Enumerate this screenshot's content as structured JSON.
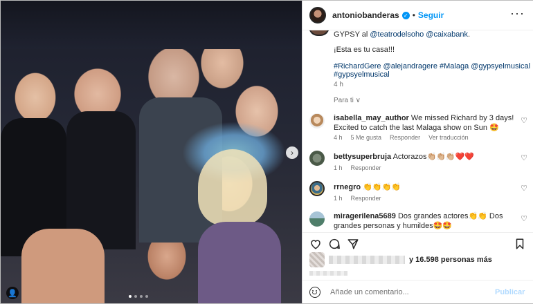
{
  "header": {
    "username": "antoniobanderas",
    "follow_label": "Seguir",
    "separator": "•",
    "verified_glyph": "✓",
    "more_label": "···"
  },
  "caption": {
    "line1_text": "GYPSY al ",
    "line1_tag1": "@teatrodelsoho",
    "line1_tag2": "@caixabank",
    "line1_end": ".",
    "line2": "¡Esta es tu casa!!!",
    "tags_line1": "#RichardGere @alejandragere #Malaga @gypsyelmusical",
    "tags_line2": "#gypsyelmusical",
    "time": "4 h",
    "para_ti": "Para ti ∨"
  },
  "comments": [
    {
      "user": "isabella_may_author",
      "text": " We missed Richard by 3 days! Excited to catch the last Malaga show on Sun 🤩",
      "meta": [
        "4 h",
        "5 Me gusta",
        "Responder",
        "Ver traducción"
      ]
    },
    {
      "user": "bettysuperbruja",
      "text": " Actorazos👏🏼👏🏼👏🏼❤️❤️",
      "meta": [
        "1 h",
        "Responder"
      ]
    },
    {
      "user": "rrnegro",
      "text": " 👏👏👏👏",
      "meta": [
        "1 h",
        "Responder"
      ]
    },
    {
      "user": "miragerilena5689",
      "text": " Dos grandes actores👏👏 Dos grandes personas y humildes🤩🤩",
      "meta": [
        "1 h",
        "Responder"
      ]
    }
  ],
  "likes_text": "y 16.598 personas más",
  "add_comment": {
    "placeholder": "Añade un comentario...",
    "publish_label": "Publicar"
  },
  "photo": {
    "next_glyph": "›",
    "user_tag_glyph": "👤"
  },
  "colors": {
    "link": "#00376b",
    "accent": "#0095f6"
  },
  "icons": [
    "heart-icon",
    "comment-icon",
    "share-icon",
    "bookmark-icon",
    "emoji-icon",
    "more-icon",
    "verified-icon"
  ]
}
